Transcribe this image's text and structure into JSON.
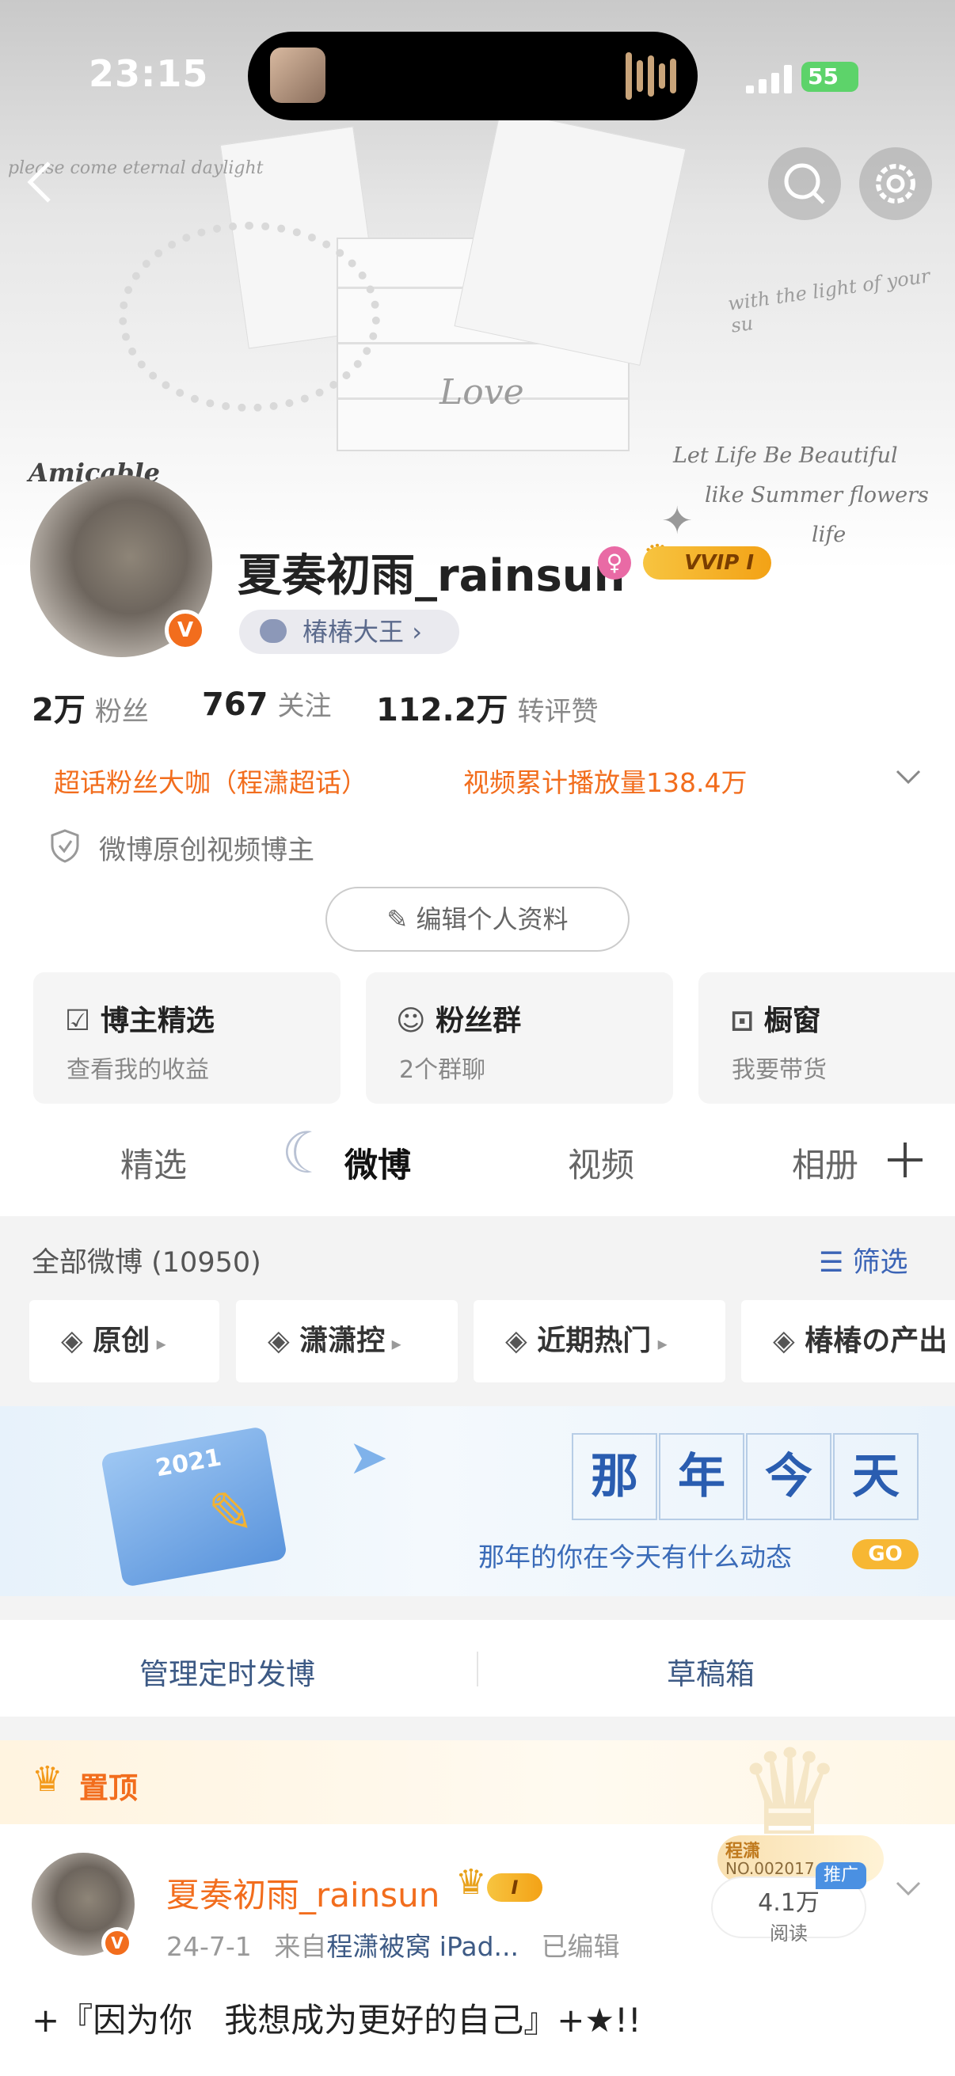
{
  "status_bar": {
    "time": "23:15",
    "battery": "55"
  },
  "banner_deco": {
    "left_script": "please come eternal daylight",
    "right_script": "with the light of your su",
    "love": "Love",
    "quote_line1": "Let Life Be Beautiful",
    "quote_line2": "like Summer flowers",
    "quote_line3": "life",
    "amicable": "Amicable"
  },
  "profile": {
    "name": "夏奏初雨_rainsun",
    "vip_label": "VVIP I",
    "verified_badge": "V",
    "group_tag": "椿椿大王",
    "stats": [
      {
        "value": "2万",
        "label": "粉丝"
      },
      {
        "value": "767",
        "label": "关注"
      },
      {
        "value": "112.2万",
        "label": "转评赞"
      }
    ],
    "honor1": "超话粉丝大咖（程潇超话）",
    "honor2": "视频累计播放量138.4万",
    "badge_text": "微博原创视频博主",
    "edit_button": "编辑个人资料"
  },
  "cards": [
    {
      "title": "博主精选",
      "sub": "查看我的收益"
    },
    {
      "title": "粉丝群",
      "sub": "2个群聊"
    },
    {
      "title": "橱窗",
      "sub": "我要带货"
    }
  ],
  "tabs": [
    "精选",
    "微博",
    "视频",
    "相册"
  ],
  "feed": {
    "header": "全部微博 (10950)",
    "filter": "筛选",
    "chips": [
      "原创",
      "潇潇控",
      "近期热门",
      "椿椿の产出"
    ]
  },
  "memory_banner": {
    "calendar_year": "2021",
    "title_chars": [
      "那",
      "年",
      "今",
      "天"
    ],
    "subtitle": "那年的你在今天有什么动态",
    "go": "GO"
  },
  "actions": {
    "scheduled": "管理定时发博",
    "drafts": "草稿箱"
  },
  "pinned": {
    "label": "置顶",
    "author": "夏奏初雨_rainsun",
    "vip_level": "I",
    "date": "24-7-1",
    "source_prefix": "来自",
    "source": "程潇被窝 iPad...",
    "edited": "已编辑",
    "sticker_name": "程潇",
    "sticker_no": "NO.002017",
    "promo": "推广",
    "reads": "4.1万",
    "reads_label": "阅读",
    "text": "+『因为你   我想成为更好的自己』+★!!"
  },
  "colors": {
    "accent_orange": "#f26d1d",
    "link_blue": "#5b6a8c",
    "vip_gold": "#f7c440"
  }
}
